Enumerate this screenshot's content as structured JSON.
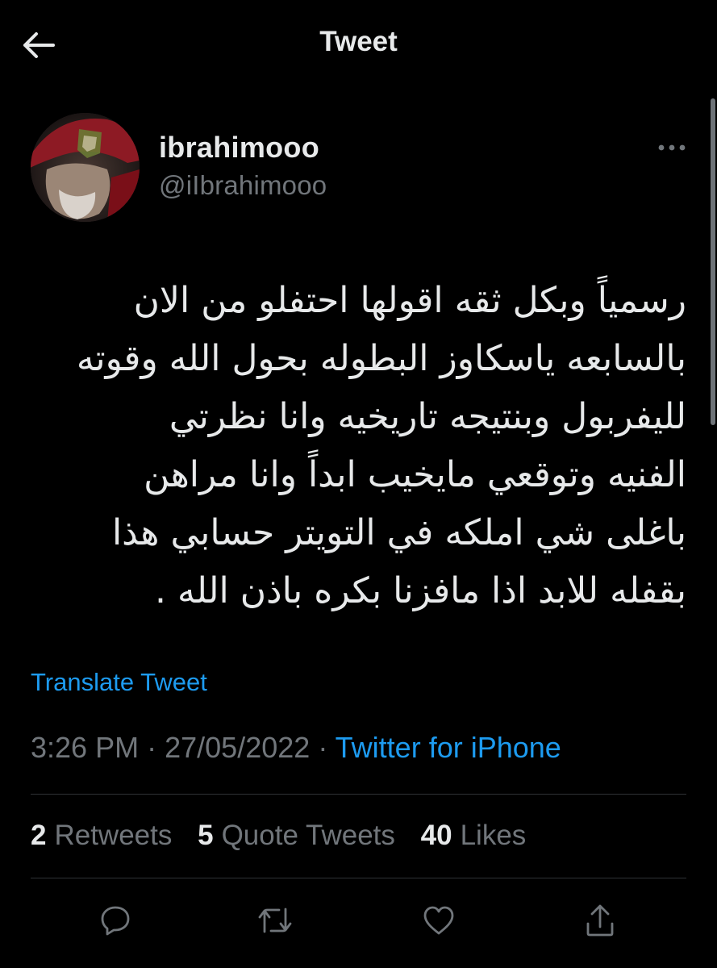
{
  "header": {
    "title": "Tweet",
    "back_icon": "arrow-left-icon"
  },
  "tweet": {
    "author": {
      "display_name": "ibrahimooo",
      "handle": "@iIbrahimooo"
    },
    "more_icon": "more-horizontal-icon",
    "text_lines": [
      "رسمياً وبكل ثقه اقولها احتفلو من الان",
      "بالسابعه ياسكاوز البطوله بحول الله وقوته",
      "لليفربول وبنتيجه تاريخيه وانا نظرتي",
      "الفنيه وتوقعي مايخيب ابداً وانا مراهن",
      "باغلى شي املكه في التويتر حسابي هذا",
      "بقفله للابد اذا مافزنا بكره باذن الله ."
    ],
    "translate_label": "Translate Tweet",
    "time": "3:26 PM",
    "separator": "·",
    "date": "27/05/2022",
    "source": "Twitter for iPhone"
  },
  "stats": {
    "retweets": {
      "count": "2",
      "label": "Retweets"
    },
    "quotes": {
      "count": "5",
      "label": "Quote Tweets"
    },
    "likes": {
      "count": "40",
      "label": "Likes"
    }
  },
  "actions": [
    "reply-icon",
    "retweet-icon",
    "like-icon",
    "share-icon"
  ],
  "colors": {
    "background": "#000000",
    "text": "#e7e9ea",
    "secondary": "#71767b",
    "accent": "#1d9bf0",
    "divider": "#2f3336"
  }
}
